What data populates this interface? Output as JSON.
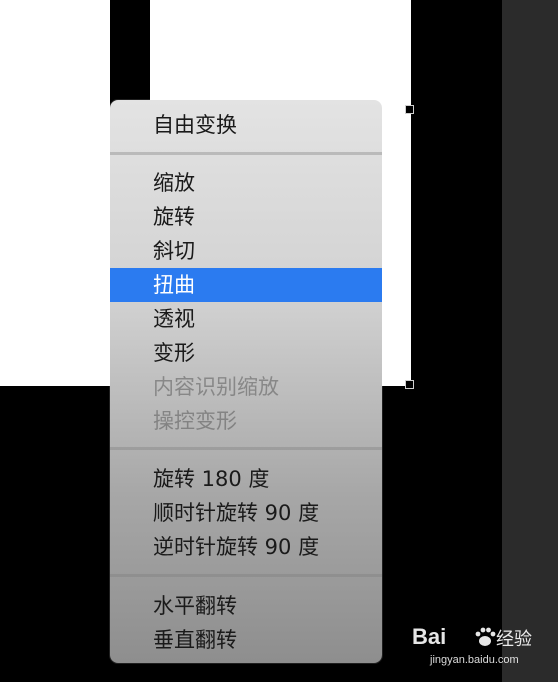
{
  "menu": {
    "items": [
      {
        "label": "自由变换",
        "state": "normal"
      },
      {
        "label": "缩放",
        "state": "normal"
      },
      {
        "label": "旋转",
        "state": "normal"
      },
      {
        "label": "斜切",
        "state": "normal"
      },
      {
        "label": "扭曲",
        "state": "highlighted"
      },
      {
        "label": "透视",
        "state": "normal"
      },
      {
        "label": "变形",
        "state": "normal"
      },
      {
        "label": "内容识别缩放",
        "state": "disabled"
      },
      {
        "label": "操控变形",
        "state": "disabled"
      },
      {
        "label": "旋转 180 度",
        "state": "normal"
      },
      {
        "label": "顺时针旋转 90 度",
        "state": "normal"
      },
      {
        "label": "逆时针旋转 90 度",
        "state": "normal"
      },
      {
        "label": "水平翻转",
        "state": "normal"
      },
      {
        "label": "垂直翻转",
        "state": "normal"
      }
    ]
  },
  "colors": {
    "highlight": "#2b7bf0",
    "menu_background": "#d2d2d2",
    "canvas": "#ffffff",
    "background": "#000000"
  },
  "watermark": {
    "logo": "Bai",
    "logo_icon": "paw-icon",
    "brand": "经验",
    "url": "jingyan.baidu.com"
  }
}
